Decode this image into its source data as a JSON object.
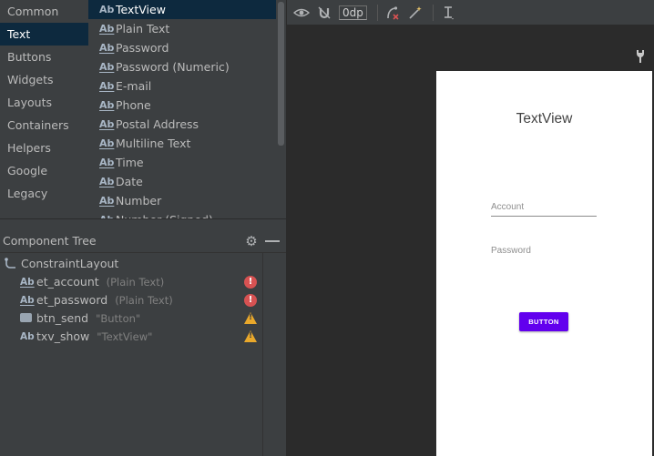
{
  "palette": {
    "categories": [
      {
        "label": "Common"
      },
      {
        "label": "Text"
      },
      {
        "label": "Buttons"
      },
      {
        "label": "Widgets"
      },
      {
        "label": "Layouts"
      },
      {
        "label": "Containers"
      },
      {
        "label": "Helpers"
      },
      {
        "label": "Google"
      },
      {
        "label": "Legacy"
      }
    ],
    "selected_category": "Text",
    "widgets": [
      {
        "icon": "Ab",
        "label": "TextView"
      },
      {
        "icon": "Ab",
        "label": "Plain Text"
      },
      {
        "icon": "Ab",
        "label": "Password"
      },
      {
        "icon": "Ab",
        "label": "Password (Numeric)"
      },
      {
        "icon": "Ab",
        "label": "E-mail"
      },
      {
        "icon": "Ab",
        "label": "Phone"
      },
      {
        "icon": "Ab",
        "label": "Postal Address"
      },
      {
        "icon": "Ab",
        "label": "Multiline Text"
      },
      {
        "icon": "Ab",
        "label": "Time"
      },
      {
        "icon": "Ab",
        "label": "Date"
      },
      {
        "icon": "Ab",
        "label": "Number"
      },
      {
        "icon": "Ab",
        "label": "Number (Signed)"
      }
    ],
    "selected_widget": "TextView"
  },
  "component_tree": {
    "title": "Component Tree",
    "root": {
      "label": "ConstraintLayout"
    },
    "nodes": [
      {
        "icon": "Ab",
        "name": "et_account",
        "type": "(Plain Text)",
        "status": "error"
      },
      {
        "icon": "Ab",
        "name": "et_password",
        "type": "(Plain Text)",
        "status": "error"
      },
      {
        "icon": "button-icon",
        "name": "btn_send",
        "type": "\"Button\"",
        "status": "warning"
      },
      {
        "icon": "Ab",
        "name": "txv_show",
        "type": "\"TextView\"",
        "status": "warning"
      }
    ],
    "error_mark": "!",
    "warning_mark": "!"
  },
  "toolbar": {
    "default_margin": "0dp"
  },
  "preview": {
    "textview_text": "TextView",
    "account_hint": "Account",
    "password_hint": "Password",
    "button_text": "BUTTON",
    "button_color": "#6200ee"
  },
  "colors": {
    "panel_bg": "#3c3f41",
    "canvas_bg": "#2b2b2b",
    "selection_bg": "#0d293e",
    "error": "#d75252",
    "warning": "#e9a82b"
  }
}
